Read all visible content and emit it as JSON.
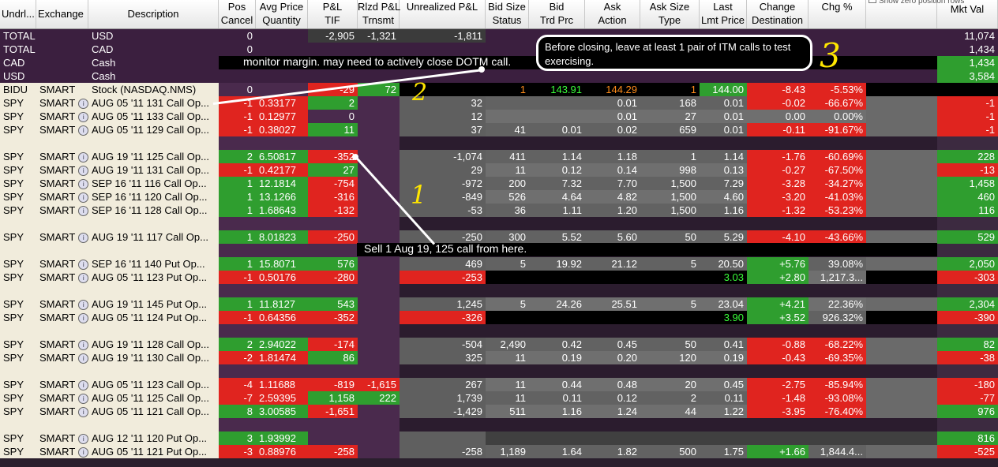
{
  "header": {
    "cols": [
      {
        "key": "undrl",
        "l1": "Undrl...",
        "l2": ""
      },
      {
        "key": "exch",
        "l1": "Exchange",
        "l2": ""
      },
      {
        "key": "desc",
        "l1": "Description",
        "l2": ""
      },
      {
        "key": "pos",
        "l1": "Pos",
        "l2": "Cancel"
      },
      {
        "key": "avg",
        "l1": "Avg Price",
        "l2": "Quantity"
      },
      {
        "key": "pnl",
        "l1": "P&L",
        "l2": "TIF"
      },
      {
        "key": "rlzd",
        "l1": "Rlzd P&L",
        "l2": "Trnsmt"
      },
      {
        "key": "unr",
        "l1": "Unrealized P&L",
        "l2": ""
      },
      {
        "key": "bidsz",
        "l1": "Bid Size",
        "l2": "Status"
      },
      {
        "key": "bid",
        "l1": "Bid",
        "l2": "Trd Prc"
      },
      {
        "key": "ask",
        "l1": "Ask",
        "l2": "Action"
      },
      {
        "key": "asksz",
        "l1": "Ask Size",
        "l2": "Type"
      },
      {
        "key": "last",
        "l1": "Last",
        "l2": "Lmt Price"
      },
      {
        "key": "chg",
        "l1": "Change",
        "l2": "Destination"
      },
      {
        "key": "chgp",
        "l1": "Chg %",
        "l2": ""
      },
      {
        "key": "gap",
        "l1": "",
        "l2": ""
      },
      {
        "key": "mkt",
        "l1": "Mkt Val",
        "l2": ""
      }
    ],
    "top_right_hint": "Show zero position rows"
  },
  "rows": [
    {
      "u": "TOTAL",
      "e": "",
      "d": "USD",
      "pos": "0",
      "avg": "",
      "pnl": "-2,905",
      "rlzd": "-1,321",
      "unr": "-1,811",
      "bidsz": "",
      "bid": "",
      "ask": "",
      "asksz": "",
      "last": "",
      "chg": "",
      "chgp": "",
      "mkt": "11,074",
      "type": "total"
    },
    {
      "u": "TOTAL",
      "e": "",
      "d": "CAD",
      "pos": "0",
      "avg": "",
      "pnl": "",
      "rlzd": "",
      "unr": "",
      "bidsz": "",
      "bid": "",
      "ask": "",
      "asksz": "",
      "last": "",
      "chg": "",
      "chgp": "",
      "mkt": "1,434",
      "type": "total"
    },
    {
      "u": "CAD",
      "e": "",
      "d": "Cash",
      "pos": "",
      "avg": "",
      "pnl": "",
      "rlzd": "",
      "unr": "",
      "bidsz": "",
      "bid": "",
      "ask": "",
      "asksz": "",
      "last": "",
      "chg": "",
      "chgp": "",
      "mkt": "1,434",
      "type": "cash"
    },
    {
      "u": "USD",
      "e": "",
      "d": "Cash",
      "pos": "",
      "avg": "",
      "pnl": "",
      "rlzd": "",
      "unr": "",
      "bidsz": "",
      "bid": "",
      "ask": "",
      "asksz": "",
      "last": "",
      "chg": "",
      "chgp": "",
      "mkt": "3,584",
      "type": "cash"
    },
    {
      "u": "BIDU",
      "e": "SMART",
      "d": "Stock (NASDAQ.NMS)",
      "pos": "0",
      "avg": "",
      "pnl": "-29",
      "rlzd": "72",
      "unr": "",
      "bidsz": "1",
      "bid": "143.91",
      "ask": "144.29",
      "asksz": "1",
      "last": "144.00",
      "chg": "-8.43",
      "chgp": "-5.53%",
      "mkt": "",
      "type": "stock"
    },
    {
      "u": "SPY",
      "e": "SMART",
      "d": "AUG 05 '11 131 Call Op...",
      "pos": "-1",
      "avg": "0.33177",
      "pnl": "2",
      "rlzd": "",
      "unr": "32",
      "bidsz": "",
      "bid": "",
      "ask": "0.01",
      "asksz": "168",
      "last": "0.01",
      "chg": "-0.02",
      "chgp": "-66.67%",
      "mkt": "-1",
      "type": "opt"
    },
    {
      "u": "SPY",
      "e": "SMART",
      "d": "AUG 05 '11 133 Call Op...",
      "pos": "-1",
      "avg": "0.12977",
      "pnl": "0",
      "rlzd": "",
      "unr": "12",
      "bidsz": "",
      "bid": "",
      "ask": "0.01",
      "asksz": "27",
      "last": "0.01",
      "chg": "0.00",
      "chgp": "0.00%",
      "mkt": "-1",
      "type": "opt"
    },
    {
      "u": "SPY",
      "e": "SMART",
      "d": "AUG 05 '11 129 Call Op...",
      "pos": "-1",
      "avg": "0.38027",
      "pnl": "11",
      "rlzd": "",
      "unr": "37",
      "bidsz": "41",
      "bid": "0.01",
      "ask": "0.02",
      "asksz": "659",
      "last": "0.01",
      "chg": "-0.11",
      "chgp": "-91.67%",
      "mkt": "-1",
      "type": "opt"
    },
    {
      "type": "spacer"
    },
    {
      "u": "SPY",
      "e": "SMART",
      "d": "AUG 19 '11 125 Call Op...",
      "pos": "2",
      "avg": "6.50817",
      "pnl": "-352",
      "rlzd": "",
      "unr": "-1,074",
      "bidsz": "411",
      "bid": "1.14",
      "ask": "1.18",
      "asksz": "1",
      "last": "1.14",
      "chg": "-1.76",
      "chgp": "-60.69%",
      "mkt": "228",
      "type": "opt"
    },
    {
      "u": "SPY",
      "e": "SMART",
      "d": "AUG 19 '11 131 Call Op...",
      "pos": "-1",
      "avg": "0.42177",
      "pnl": "27",
      "rlzd": "",
      "unr": "29",
      "bidsz": "11",
      "bid": "0.12",
      "ask": "0.14",
      "asksz": "998",
      "last": "0.13",
      "chg": "-0.27",
      "chgp": "-67.50%",
      "mkt": "-13",
      "type": "opt"
    },
    {
      "u": "SPY",
      "e": "SMART",
      "d": "SEP 16 '11 116 Call Op...",
      "pos": "1",
      "avg": "12.1814",
      "pnl": "-754",
      "rlzd": "",
      "unr": "-972",
      "bidsz": "200",
      "bid": "7.32",
      "ask": "7.70",
      "asksz": "1,500",
      "last": "7.29",
      "chg": "-3.28",
      "chgp": "-34.27%",
      "mkt": "1,458",
      "type": "opt"
    },
    {
      "u": "SPY",
      "e": "SMART",
      "d": "SEP 16 '11 120 Call Op...",
      "pos": "1",
      "avg": "13.1266",
      "pnl": "-316",
      "rlzd": "",
      "unr": "-849",
      "bidsz": "526",
      "bid": "4.64",
      "ask": "4.82",
      "asksz": "1,500",
      "last": "4.60",
      "chg": "-3.20",
      "chgp": "-41.03%",
      "mkt": "460",
      "type": "opt"
    },
    {
      "u": "SPY",
      "e": "SMART",
      "d": "SEP 16 '11 128 Call Op...",
      "pos": "1",
      "avg": "1.68643",
      "pnl": "-132",
      "rlzd": "",
      "unr": "-53",
      "bidsz": "36",
      "bid": "1.11",
      "ask": "1.20",
      "asksz": "1,500",
      "last": "1.16",
      "chg": "-1.32",
      "chgp": "-53.23%",
      "mkt": "116",
      "type": "opt"
    },
    {
      "type": "spacer"
    },
    {
      "u": "SPY",
      "e": "SMART",
      "d": "AUG 19 '11 117 Call Op...",
      "pos": "1",
      "avg": "8.01823",
      "pnl": "-250",
      "rlzd": "",
      "unr": "-250",
      "bidsz": "300",
      "bid": "5.52",
      "ask": "5.60",
      "asksz": "50",
      "last": "5.29",
      "chg": "-4.10",
      "chgp": "-43.66%",
      "mkt": "529",
      "type": "opt"
    },
    {
      "type": "spacer"
    },
    {
      "u": "SPY",
      "e": "SMART",
      "d": "SEP 16 '11 140 Put Op...",
      "pos": "1",
      "avg": "15.8071",
      "pnl": "576",
      "rlzd": "",
      "unr": "469",
      "bidsz": "5",
      "bid": "19.92",
      "ask": "21.12",
      "asksz": "5",
      "last": "20.50",
      "chg": "+5.76",
      "chgp": "39.08%",
      "mkt": "2,050",
      "type": "opt"
    },
    {
      "u": "SPY",
      "e": "SMART",
      "d": "AUG 05 '11 123 Put Op...",
      "pos": "-1",
      "avg": "0.50176",
      "pnl": "-280",
      "rlzd": "",
      "unr": "-253",
      "bidsz": "",
      "bid": "",
      "ask": "",
      "asksz": "",
      "last": "3.03",
      "chg": "+2.80",
      "chgp": "1,217.3...",
      "mkt": "-303",
      "type": "opt"
    },
    {
      "type": "spacer"
    },
    {
      "u": "SPY",
      "e": "SMART",
      "d": "AUG 19 '11 145 Put Op...",
      "pos": "1",
      "avg": "11.8127",
      "pnl": "543",
      "rlzd": "",
      "unr": "1,245",
      "bidsz": "5",
      "bid": "24.26",
      "ask": "25.51",
      "asksz": "5",
      "last": "23.04",
      "chg": "+4.21",
      "chgp": "22.36%",
      "mkt": "2,304",
      "type": "opt"
    },
    {
      "u": "SPY",
      "e": "SMART",
      "d": "AUG 05 '11 124 Put Op...",
      "pos": "-1",
      "avg": "0.64356",
      "pnl": "-352",
      "rlzd": "",
      "unr": "-326",
      "bidsz": "",
      "bid": "",
      "ask": "",
      "asksz": "",
      "last": "3.90",
      "chg": "+3.52",
      "chgp": "926.32%",
      "mkt": "-390",
      "type": "opt"
    },
    {
      "type": "spacer"
    },
    {
      "u": "SPY",
      "e": "SMART",
      "d": "AUG 19 '11 128 Call Op...",
      "pos": "2",
      "avg": "2.94022",
      "pnl": "-174",
      "rlzd": "",
      "unr": "-504",
      "bidsz": "2,490",
      "bid": "0.42",
      "ask": "0.45",
      "asksz": "50",
      "last": "0.41",
      "chg": "-0.88",
      "chgp": "-68.22%",
      "mkt": "82",
      "type": "opt"
    },
    {
      "u": "SPY",
      "e": "SMART",
      "d": "AUG 19 '11 130 Call Op...",
      "pos": "-2",
      "avg": "1.81474",
      "pnl": "86",
      "rlzd": "",
      "unr": "325",
      "bidsz": "11",
      "bid": "0.19",
      "ask": "0.20",
      "asksz": "120",
      "last": "0.19",
      "chg": "-0.43",
      "chgp": "-69.35%",
      "mkt": "-38",
      "type": "opt"
    },
    {
      "type": "spacer"
    },
    {
      "u": "SPY",
      "e": "SMART",
      "d": "AUG 05 '11 123 Call Op...",
      "pos": "-4",
      "avg": "1.11688",
      "pnl": "-819",
      "rlzd": "-1,615",
      "unr": "267",
      "bidsz": "11",
      "bid": "0.44",
      "ask": "0.48",
      "asksz": "20",
      "last": "0.45",
      "chg": "-2.75",
      "chgp": "-85.94%",
      "mkt": "-180",
      "type": "opt"
    },
    {
      "u": "SPY",
      "e": "SMART",
      "d": "AUG 05 '11 125 Call Op...",
      "pos": "-7",
      "avg": "2.59395",
      "pnl": "1,158",
      "rlzd": "222",
      "unr": "1,739",
      "bidsz": "11",
      "bid": "0.11",
      "ask": "0.12",
      "asksz": "2",
      "last": "0.11",
      "chg": "-1.48",
      "chgp": "-93.08%",
      "mkt": "-77",
      "type": "opt"
    },
    {
      "u": "SPY",
      "e": "SMART",
      "d": "AUG 05 '11 121 Call Op...",
      "pos": "8",
      "avg": "3.00585",
      "pnl": "-1,651",
      "rlzd": "",
      "unr": "-1,429",
      "bidsz": "511",
      "bid": "1.16",
      "ask": "1.24",
      "asksz": "44",
      "last": "1.22",
      "chg": "-3.95",
      "chgp": "-76.40%",
      "mkt": "976",
      "type": "opt"
    },
    {
      "type": "spacer"
    },
    {
      "u": "SPY",
      "e": "SMART",
      "d": "AUG 12 '11 120 Put Op...",
      "pos": "3",
      "avg": "1.93992",
      "pnl": "",
      "rlzd": "",
      "unr": "",
      "bidsz": "",
      "bid": "",
      "ask": "",
      "asksz": "",
      "last": "",
      "chg": "",
      "chgp": "",
      "mkt": "816",
      "type": "opt"
    },
    {
      "u": "SPY",
      "e": "SMART",
      "d": "AUG 05 '11 121 Put Op...",
      "pos": "-3",
      "avg": "0.88976",
      "pnl": "-258",
      "rlzd": "",
      "unr": "-258",
      "bidsz": "1,189",
      "bid": "1.64",
      "ask": "1.82",
      "asksz": "500",
      "last": "1.75",
      "chg": "+1.66",
      "chgp": "1,844.4...",
      "mkt": "-525",
      "type": "opt"
    }
  ],
  "annotations": {
    "note1": "monitor margin. may need to actively close DOTM call.",
    "note2": "Before closing, leave at least 1 pair of ITM calls to test exercising.",
    "note3": "Sell 1 Aug 19, 125 call from here.",
    "mark1": "1",
    "mark2": "2",
    "mark3": "3"
  },
  "colors": {
    "green": "#2f9e2f",
    "red": "#e0241f",
    "orange": "#ff8c1a",
    "lightgreen": "#39ff39"
  }
}
